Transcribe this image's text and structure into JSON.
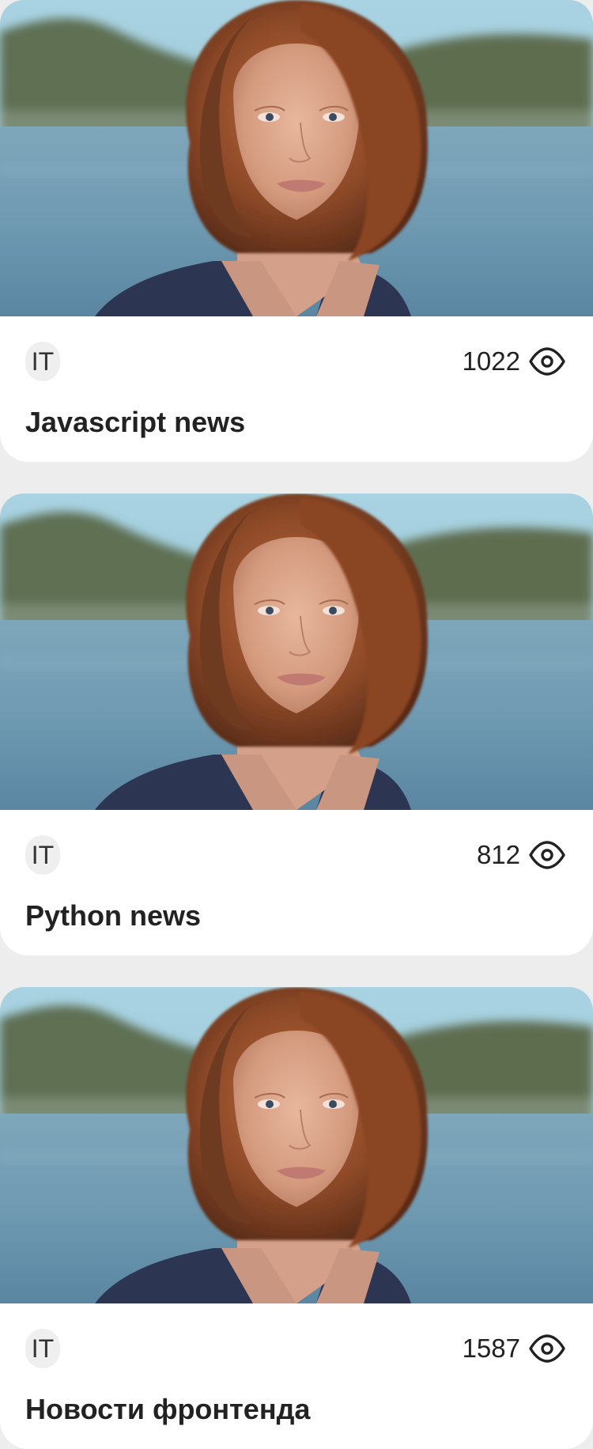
{
  "colors": {
    "page_background": "#ededed",
    "card_background": "#ffffff",
    "tag_background": "#efefef",
    "text_primary": "#222222"
  },
  "cards": [
    {
      "image": "portrait-photo",
      "tag": "IT",
      "views": "1022",
      "views_icon": "eye-icon",
      "title": "Javascript news"
    },
    {
      "image": "portrait-photo",
      "tag": "IT",
      "views": "812",
      "views_icon": "eye-icon",
      "title": "Python news"
    },
    {
      "image": "portrait-photo",
      "tag": "IT",
      "views": "1587",
      "views_icon": "eye-icon",
      "title": "Новости фронтенда"
    }
  ]
}
